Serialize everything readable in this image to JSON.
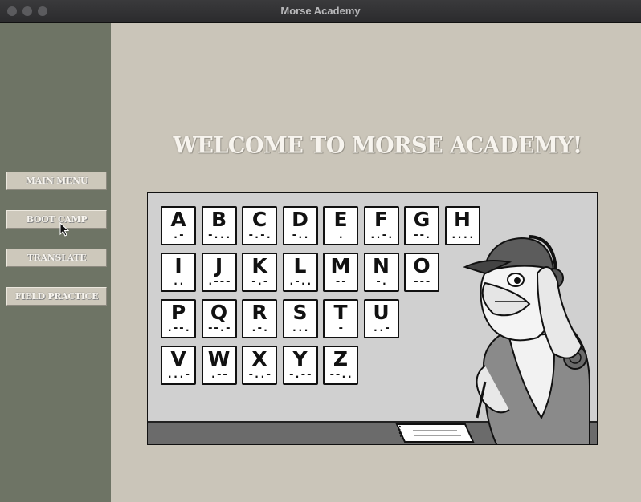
{
  "window": {
    "title": "Morse Academy"
  },
  "sidebar": {
    "items": [
      {
        "label": "MAIN MENU"
      },
      {
        "label": "BOOT CAMP"
      },
      {
        "label": "TRANSLATE"
      },
      {
        "label": "FIELD PRACTICE"
      }
    ]
  },
  "main": {
    "heading": "WELCOME TO MORSE ACADEMY!"
  },
  "poster": {
    "cards": [
      {
        "letter": "A",
        "code": ".-"
      },
      {
        "letter": "B",
        "code": "-..."
      },
      {
        "letter": "C",
        "code": "-.-."
      },
      {
        "letter": "D",
        "code": "-.."
      },
      {
        "letter": "E",
        "code": "."
      },
      {
        "letter": "F",
        "code": "..-."
      },
      {
        "letter": "G",
        "code": "--."
      },
      {
        "letter": "H",
        "code": "...."
      },
      {
        "letter": "I",
        "code": ".."
      },
      {
        "letter": "J",
        "code": ".---"
      },
      {
        "letter": "K",
        "code": "-.-"
      },
      {
        "letter": "L",
        "code": ".-.."
      },
      {
        "letter": "M",
        "code": "--"
      },
      {
        "letter": "N",
        "code": "-."
      },
      {
        "letter": "O",
        "code": "---"
      },
      {
        "letter": "P",
        "code": ".--."
      },
      {
        "letter": "Q",
        "code": "--.-"
      },
      {
        "letter": "R",
        "code": ".-."
      },
      {
        "letter": "S",
        "code": "..."
      },
      {
        "letter": "T",
        "code": "-"
      },
      {
        "letter": "U",
        "code": "..-"
      },
      {
        "letter": "V",
        "code": "...-"
      },
      {
        "letter": "W",
        "code": ".--"
      },
      {
        "letter": "X",
        "code": "-..-"
      },
      {
        "letter": "Y",
        "code": "-.--"
      },
      {
        "letter": "Z",
        "code": "--.."
      }
    ],
    "mascot": "eagle-soldier-with-headset-illustration"
  },
  "colors": {
    "sidebar": "#6e7465",
    "background": "#cac5b9",
    "button": "#cdc8bb",
    "heading_text": "#f7f4ee"
  }
}
